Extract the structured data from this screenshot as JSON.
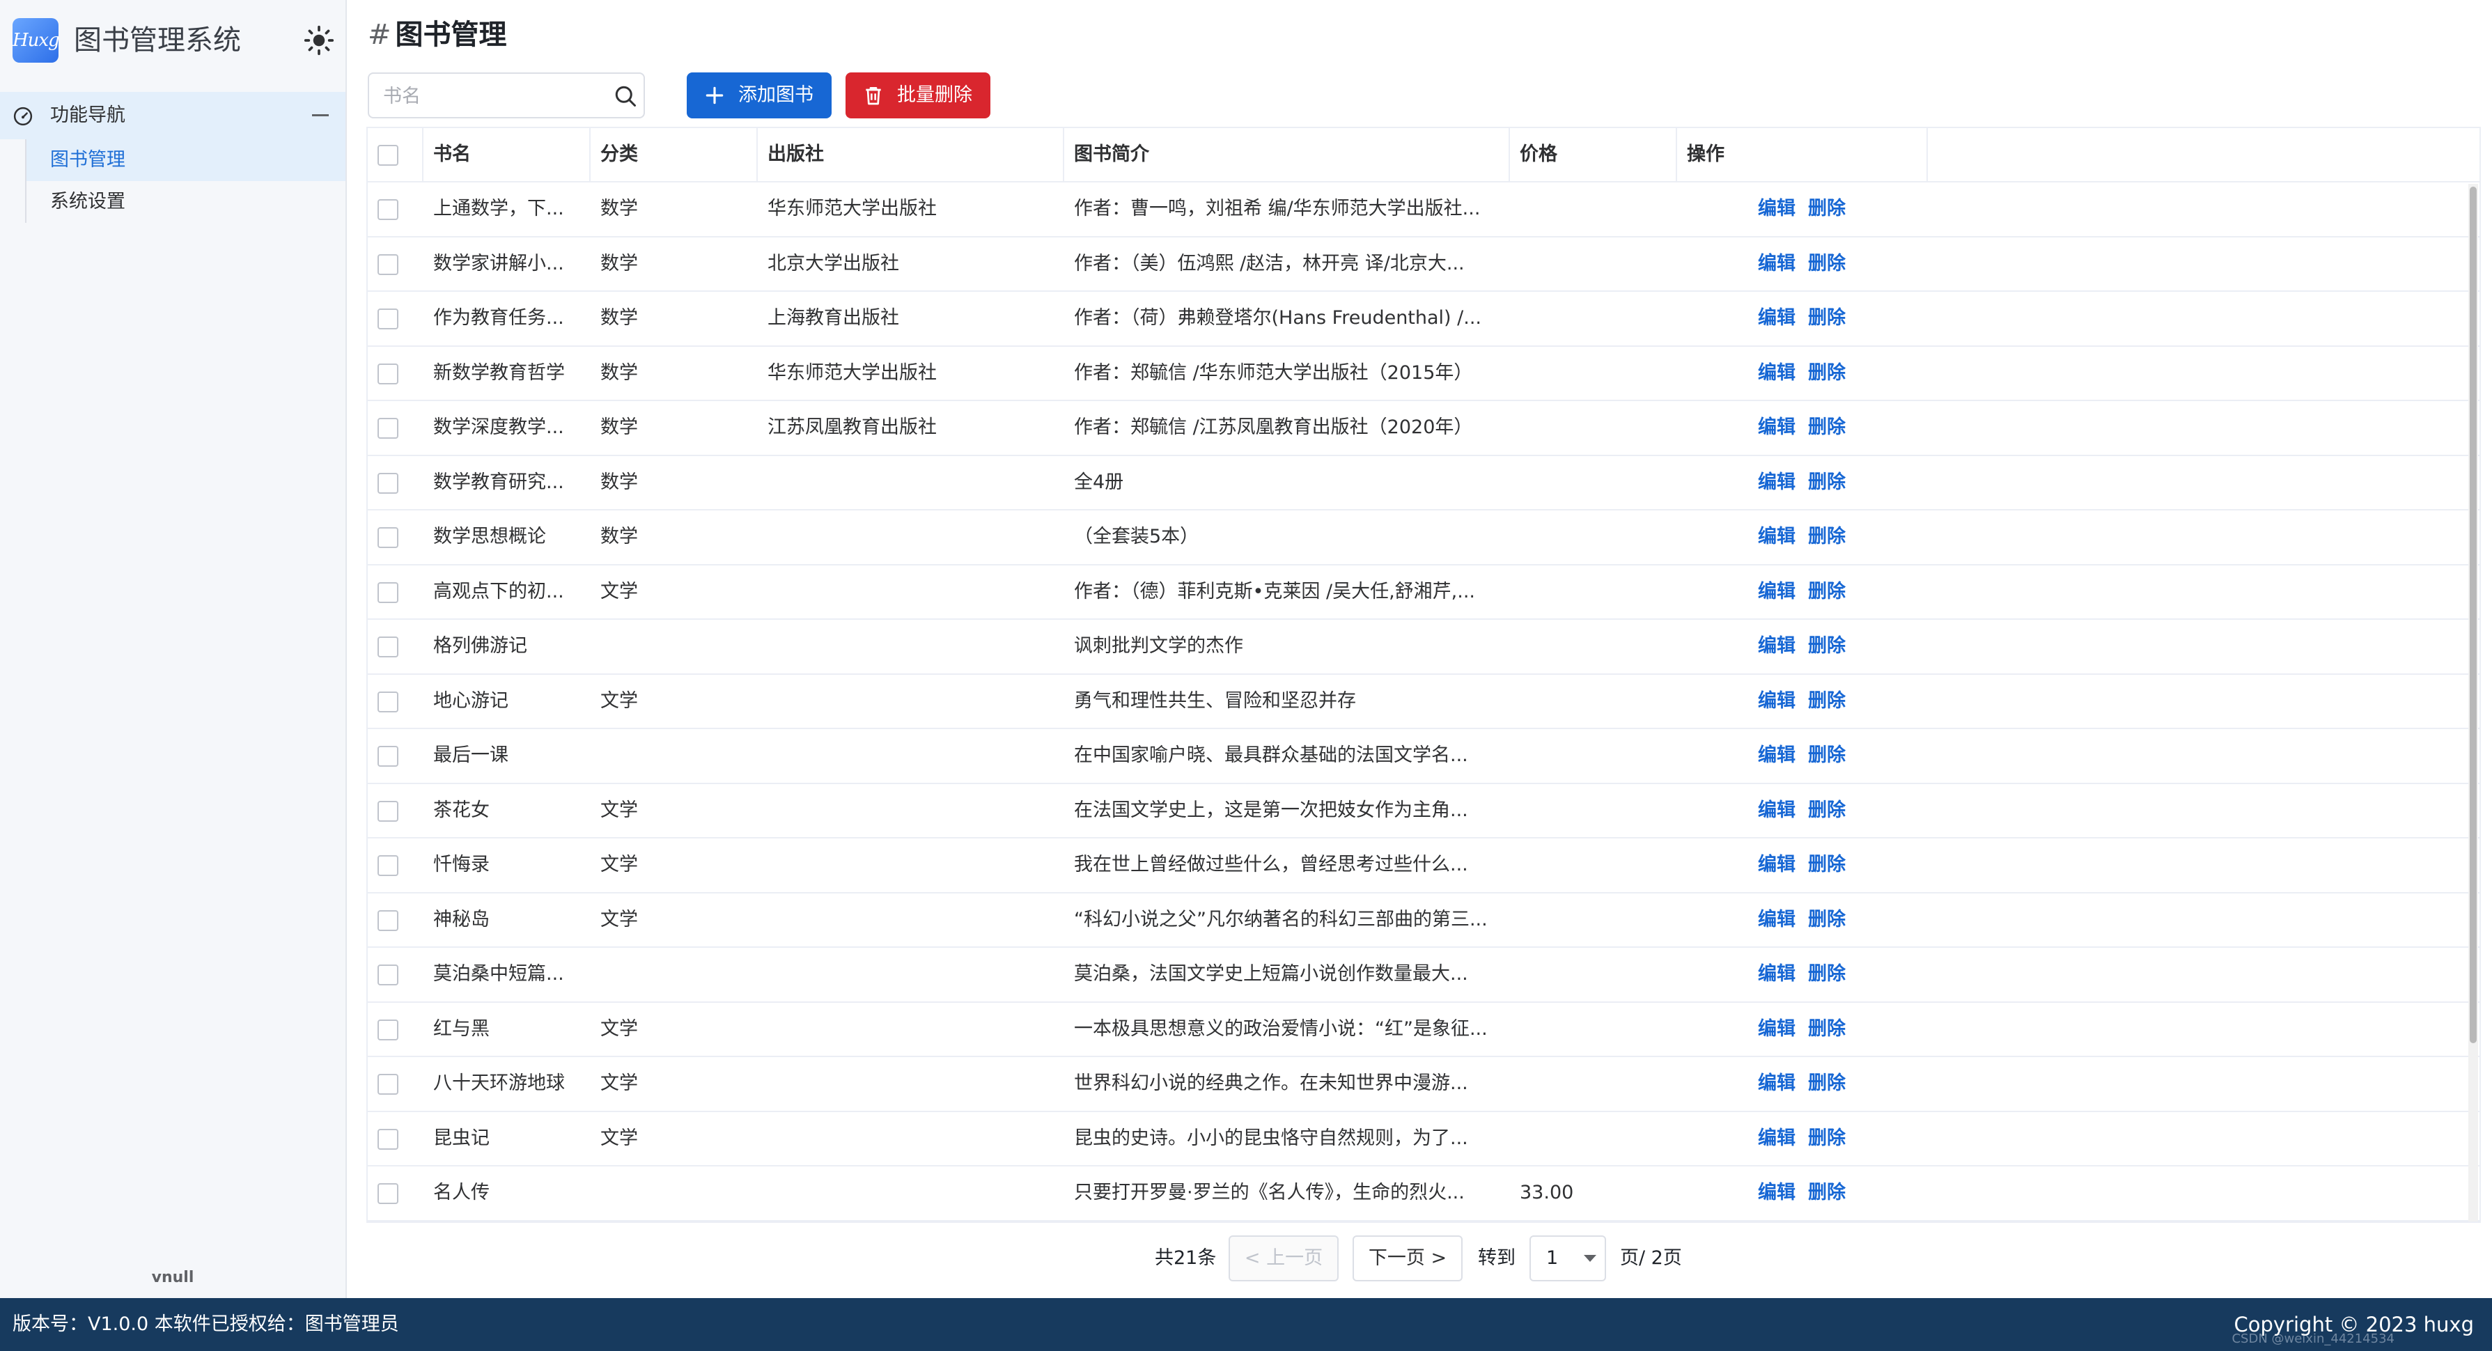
{
  "app": {
    "logo_text": "Huxg",
    "title": "图书管理系统"
  },
  "sidebar": {
    "group_label": "功能导航",
    "items": [
      {
        "label": "图书管理",
        "active": true
      },
      {
        "label": "系统设置",
        "active": false
      }
    ],
    "footer": "vnull"
  },
  "page": {
    "hash": "#",
    "title": "图书管理"
  },
  "search": {
    "placeholder": "书名",
    "value": ""
  },
  "toolbar": {
    "add_label": "添加图书",
    "delete_label": "批量删除"
  },
  "table": {
    "headers": {
      "name": "书名",
      "category": "分类",
      "publisher": "出版社",
      "intro": "图书简介",
      "price": "价格",
      "ops": "操作"
    },
    "edit_label": "编辑",
    "delete_label": "删除",
    "rows": [
      {
        "name": "上通数学，下...",
        "category": "数学",
        "publisher": "华东师范大学出版社",
        "intro": "作者：曹一鸣，刘祖希 编/华东师范大学出版社...",
        "price": ""
      },
      {
        "name": "数学家讲解小...",
        "category": "数学",
        "publisher": "北京大学出版社",
        "intro": "作者：（美）伍鸿熙 /赵洁，林开亮 译/北京大...",
        "price": ""
      },
      {
        "name": "作为教育任务...",
        "category": "数学",
        "publisher": "上海教育出版社",
        "intro": "作者：（荷）弗赖登塔尔(Hans Freudenthal) /...",
        "price": ""
      },
      {
        "name": "新数学教育哲学",
        "category": "数学",
        "publisher": "华东师范大学出版社",
        "intro": "作者：郑毓信 /华东师范大学出版社（2015年）",
        "price": ""
      },
      {
        "name": "数学深度教学...",
        "category": "数学",
        "publisher": "江苏凤凰教育出版社",
        "intro": "作者：郑毓信  /江苏凤凰教育出版社（2020年）",
        "price": ""
      },
      {
        "name": "数学教育研究...",
        "category": "数学",
        "publisher": "",
        "intro": "全4册",
        "price": ""
      },
      {
        "name": "数学思想概论",
        "category": "数学",
        "publisher": "",
        "intro": "（全套装5本）",
        "price": ""
      },
      {
        "name": "高观点下的初...",
        "category": "文学",
        "publisher": "",
        "intro": "作者：（德）菲利克斯•克莱因 /吴大任,舒湘芹,...",
        "price": ""
      },
      {
        "name": "格列佛游记",
        "category": "",
        "publisher": "",
        "intro": "讽刺批判文学的杰作",
        "price": ""
      },
      {
        "name": "地心游记",
        "category": "文学",
        "publisher": "",
        "intro": "勇气和理性共生、冒险和坚忍并存",
        "price": ""
      },
      {
        "name": "最后一课",
        "category": "",
        "publisher": "",
        "intro": "在中国家喻户晓、最具群众基础的法国文学名...",
        "price": ""
      },
      {
        "name": "茶花女",
        "category": "文学",
        "publisher": "",
        "intro": "在法国文学史上，这是第一次把妓女作为主角...",
        "price": ""
      },
      {
        "name": "忏悔录",
        "category": "文学",
        "publisher": "",
        "intro": "我在世上曾经做过些什么，曾经思考过些什么...",
        "price": ""
      },
      {
        "name": "神秘岛",
        "category": "文学",
        "publisher": "",
        "intro": "“科幻小说之父”凡尔纳著名的科幻三部曲的第三...",
        "price": ""
      },
      {
        "name": "莫泊桑中短篇...",
        "category": "",
        "publisher": "",
        "intro": "莫泊桑，法国文学史上短篇小说创作数量最大...",
        "price": ""
      },
      {
        "name": "红与黑",
        "category": "文学",
        "publisher": "",
        "intro": "一本极具思想意义的政治爱情小说：“红”是象征...",
        "price": ""
      },
      {
        "name": "八十天环游地球",
        "category": "文学",
        "publisher": "",
        "intro": "世界科幻小说的经典之作。在未知世界中漫游...",
        "price": ""
      },
      {
        "name": "昆虫记",
        "category": "文学",
        "publisher": "",
        "intro": "昆虫的史诗。小小的昆虫恪守自然规则，为了...",
        "price": ""
      },
      {
        "name": "名人传",
        "category": "",
        "publisher": "",
        "intro": "只要打开罗曼·罗兰的《名人传》，生命的烈火...",
        "price": "33.00"
      }
    ]
  },
  "pagination": {
    "total": "共21条",
    "prev": "< 上一页",
    "next": "下一页 >",
    "goto": "转到",
    "current": "1",
    "pages": "页/  2页"
  },
  "footer": {
    "left": "版本号：V1.0.0 本软件已授权给：图书管理员",
    "right": "Copyright © 2023 huxg",
    "watermark": "CSDN @weixin_44214534"
  },
  "colors": {
    "primary": "#1767d4",
    "danger": "#d9262e",
    "footer_bg": "#173a5e",
    "nav_active_bg": "#e3effb"
  },
  "icons": [
    "sun-icon",
    "dashboard-icon",
    "search-icon",
    "plus-icon",
    "trash-icon"
  ]
}
